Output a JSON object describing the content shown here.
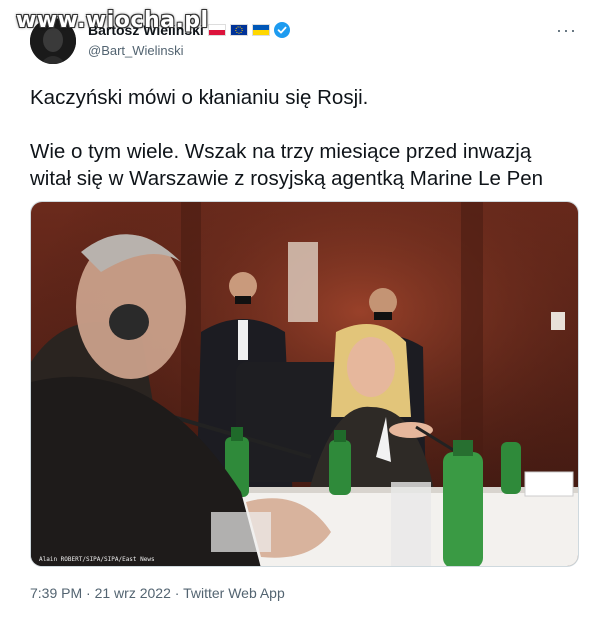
{
  "watermark": "www.wiocha.pl",
  "header": {
    "display_name": "Bartosz Wieliński",
    "handle": "@Bart_Wielinski",
    "more_label": "···",
    "flags": [
      "flag-poland",
      "flag-eu",
      "flag-ukraine"
    ],
    "verified_color": "#1d9bf0"
  },
  "tweet": {
    "paragraph_1": "Kaczyński mówi o kłanianiu się Rosji.",
    "paragraph_2": "Wie o tym wiele. Wszak na trzy miesiące przed inwazją witał się w Warszawie z rosyjską agentką Marine Le Pen"
  },
  "media": {
    "photo_credit": "Alain ROBERT/SIPA/SIPA/East News",
    "alt": "photo"
  },
  "meta": {
    "time": "7:39 PM",
    "separator": " · ",
    "date": "21 wrz 2022",
    "source": "Twitter Web App"
  }
}
